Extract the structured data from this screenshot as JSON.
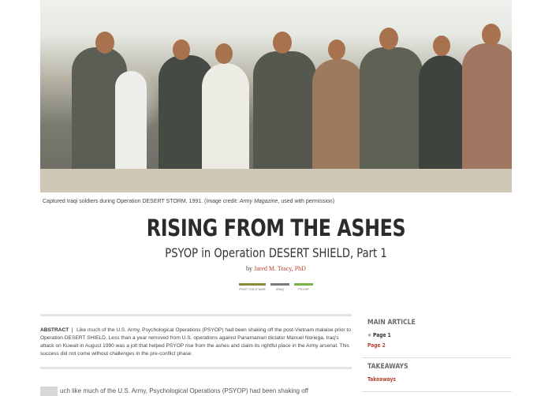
{
  "hero": {
    "caption_prefix": "Captured Iraqi soldiers during Operation DESERT STORM, 1991. (Image credit: ",
    "caption_source": "Army Magazine",
    "caption_suffix": ", used with permission)"
  },
  "article": {
    "title": "RISING FROM THE ASHES",
    "subtitle": "PSYOP in Operation DESERT SHIELD, Part 1",
    "by": "by",
    "author": "Jared M. Tracy, PhD"
  },
  "tags": [
    {
      "label": "POST COLD WAR",
      "color": "#8a8a3a"
    },
    {
      "label": "IRAQ",
      "color": "#7a7a7a"
    },
    {
      "label": "PSYOP",
      "color": "#7ab24a"
    }
  ],
  "abstract": {
    "label": "ABSTRACT",
    "text": "Like much of the U.S. Army, Psychological Operations (PSYOP) had been shaking off the post-Vietnam malaise prior to Operation DESERT SHIELD. Less than a year removed from U.S. operations against Panamanian dictator Manuel Noriega, Iraq's attack on Kuwait in August 1990 was a jolt that helped PSYOP rise from the ashes and claim its rightful place in the Army arsenal. This success did not come without challenges in the pre-conflict phase."
  },
  "sidebar": {
    "main_article": {
      "heading": "MAIN ARTICLE",
      "current": "Page 1",
      "next": "Page 2"
    },
    "takeaways": {
      "heading": "TAKEAWAYS",
      "link": "Takeaways"
    }
  },
  "body_preview": "uch like much of the U.S. Army, Psychological Operations (PSYOP) had been shaking off"
}
